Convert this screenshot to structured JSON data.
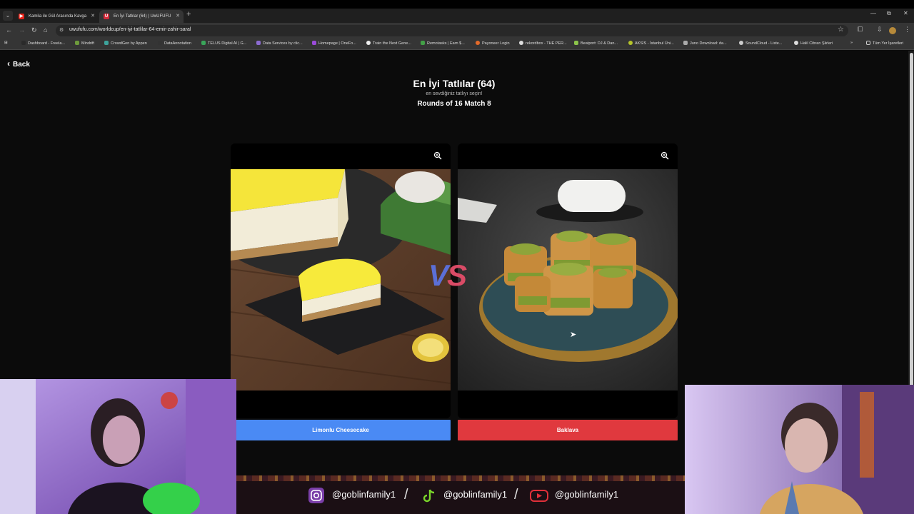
{
  "browser": {
    "tabs": [
      {
        "title": "Kamila ile Gül Arasında Kavga",
        "favicon": "youtube"
      },
      {
        "title": "En İyi Tatlılar (64) | UwUFUFU",
        "favicon": "uwufufu"
      }
    ],
    "url": "uwufufu.com/worldcup/en-iyi-tatlilar-64-emir-zahir-saral",
    "bookmarks": [
      "Dashboard - Freela...",
      "Mindrift",
      "CrowdGen by Appen",
      "DataAnnotation",
      "TELUS Digital AI | G...",
      "Data Services by clic...",
      "Homepage | OneFo...",
      "Train the Next Gene...",
      "Remotasks | Earn $...",
      "Payoneer Login",
      "rekordbox - THE PER...",
      "Beatport: DJ & Dan...",
      "AKSİS - İstanbul Üni...",
      "Juno Download: da...",
      "SoundCloud - Liste...",
      "Halil Cibran Şiirleri"
    ],
    "all_bookmarks": "Tüm Yer İşaretleri"
  },
  "page": {
    "back": "Back",
    "title": "En İyi Tatlılar (64)",
    "subtitle": "en sevdiğiniz tatlıyı seçin!",
    "round": "Rounds of 16 Match 8",
    "vs_v": "V",
    "vs_s": "S",
    "left_choice": "Limonlu Cheesecake",
    "right_choice": "Baklava",
    "left_color": "#4a8af4",
    "right_color": "#e0393e"
  },
  "overlay": {
    "handles": [
      "@goblinfamily1",
      "@goblinfamily1",
      "@goblinfamily1"
    ],
    "icons": [
      "instagram-icon",
      "tiktok-icon",
      "youtube-icon"
    ]
  }
}
